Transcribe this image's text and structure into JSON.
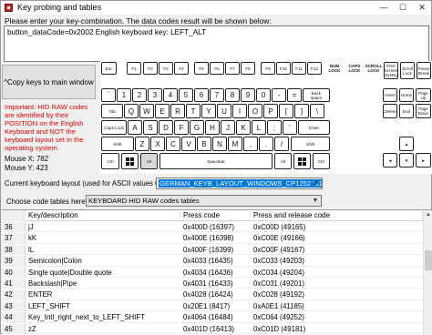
{
  "window": {
    "title": "Key probing and tables",
    "minimize_glyph": "—",
    "maximize_glyph": "☐",
    "close_glyph": "✕"
  },
  "instructions": "Please enter your key-combination. The data codes result will be shown below:",
  "output_text": "button_dataCode=0x2002   English keyboard key: LEFT_ALT",
  "copy_button": "^Copy keys to main window",
  "important_text": "Important: HID RAW codes are identified by their POSITION  on the English Keyboard and NOT the keyboard layout set in the operating system.",
  "mouse_x": "Mouse X: 782",
  "mouse_y": "Mouse Y: 423",
  "layout_label": "Current keyboard layout (used for ASCII values 0..255):",
  "layout_value": "GERMAN_KEYB_LAYOUT_WINDOWS_CP1252 \"11\"",
  "choose_label": "Choose code tables here =>",
  "choose_value": "KEYBOARD HID RAW codes tables",
  "keyboard": {
    "leds": [
      "NUM\nLOCK",
      "CAPS\nLOCK",
      "SCROLL\nLOCK"
    ],
    "esc": "Esc",
    "f_keys": [
      "F1",
      "F2",
      "F3",
      "F4",
      "F5",
      "F6",
      "F7",
      "F8",
      "F9",
      "F10",
      "F11",
      "F12"
    ],
    "print": "Print\nScreen\nSysRq",
    "scroll": "Scroll\nLock",
    "pause": "Pause\nBreak",
    "row1": [
      "`",
      "1",
      "2",
      "3",
      "4",
      "5",
      "6",
      "7",
      "8",
      "9",
      "0",
      "-",
      "="
    ],
    "backspace": "Back\nspace",
    "insert": "Insert",
    "home": "Home",
    "pageup": "Page\nUp",
    "tab": "Tab",
    "row2": [
      "Q",
      "W",
      "E",
      "R",
      "T",
      "Y",
      "U",
      "I",
      "O",
      "P",
      "[",
      "]",
      "\\"
    ],
    "delete": "Delete",
    "end": "End",
    "pagedown": "Page\nDown",
    "caps": "Caps Lock",
    "row3": [
      "A",
      "S",
      "D",
      "F",
      "G",
      "H",
      "J",
      "K",
      "L",
      ";",
      "'"
    ],
    "enter": "Enter",
    "shift": "Shift",
    "row4": [
      "Z",
      "X",
      "C",
      "V",
      "B",
      "N",
      "M",
      ",",
      ".",
      "/"
    ],
    "ctrl": "Ctrl",
    "alt": "Alt",
    "space": "Spacebar",
    "arrow_up": "▲",
    "arrow_left": "◄",
    "arrow_down": "▼",
    "arrow_right": "►"
  },
  "table": {
    "headers": [
      "Key/description",
      "Press code",
      "Press and release code"
    ],
    "rows": [
      {
        "idx": "36",
        "desc": "jJ",
        "press": "0x400D (16397)",
        "release": "0xC00D (49165)"
      },
      {
        "idx": "37",
        "desc": "kK",
        "press": "0x400E (16398)",
        "release": "0xC00E (49166)"
      },
      {
        "idx": "38",
        "desc": "lL",
        "press": "0x400F (16399)",
        "release": "0xC00F (49167)"
      },
      {
        "idx": "39",
        "desc": "Semicolon|Colon",
        "press": "0x4033 (16435)",
        "release": "0xC033 (49203)"
      },
      {
        "idx": "40",
        "desc": "Single quote|Double quote",
        "press": "0x4034 (16436)",
        "release": "0xC034 (49204)"
      },
      {
        "idx": "41",
        "desc": "Backslash|Pipe",
        "press": "0x4031 (16433)",
        "release": "0xC031 (49201)"
      },
      {
        "idx": "42",
        "desc": "ENTER",
        "press": "0x4028 (16424)",
        "release": "0xC028 (49192)"
      },
      {
        "idx": "43",
        "desc": "LEFT_SHIFT",
        "press": "0x20E1 (8417)",
        "release": "0xA0E1 (41185)"
      },
      {
        "idx": "44",
        "desc": "Key_Intl_right_next_to_LEFT_SHIFT",
        "press": "0x4064 (16484)",
        "release": "0xC064 (49252)"
      },
      {
        "idx": "45",
        "desc": "zZ",
        "press": "0x401D (16413)",
        "release": "0xC01D (49181)"
      }
    ]
  }
}
